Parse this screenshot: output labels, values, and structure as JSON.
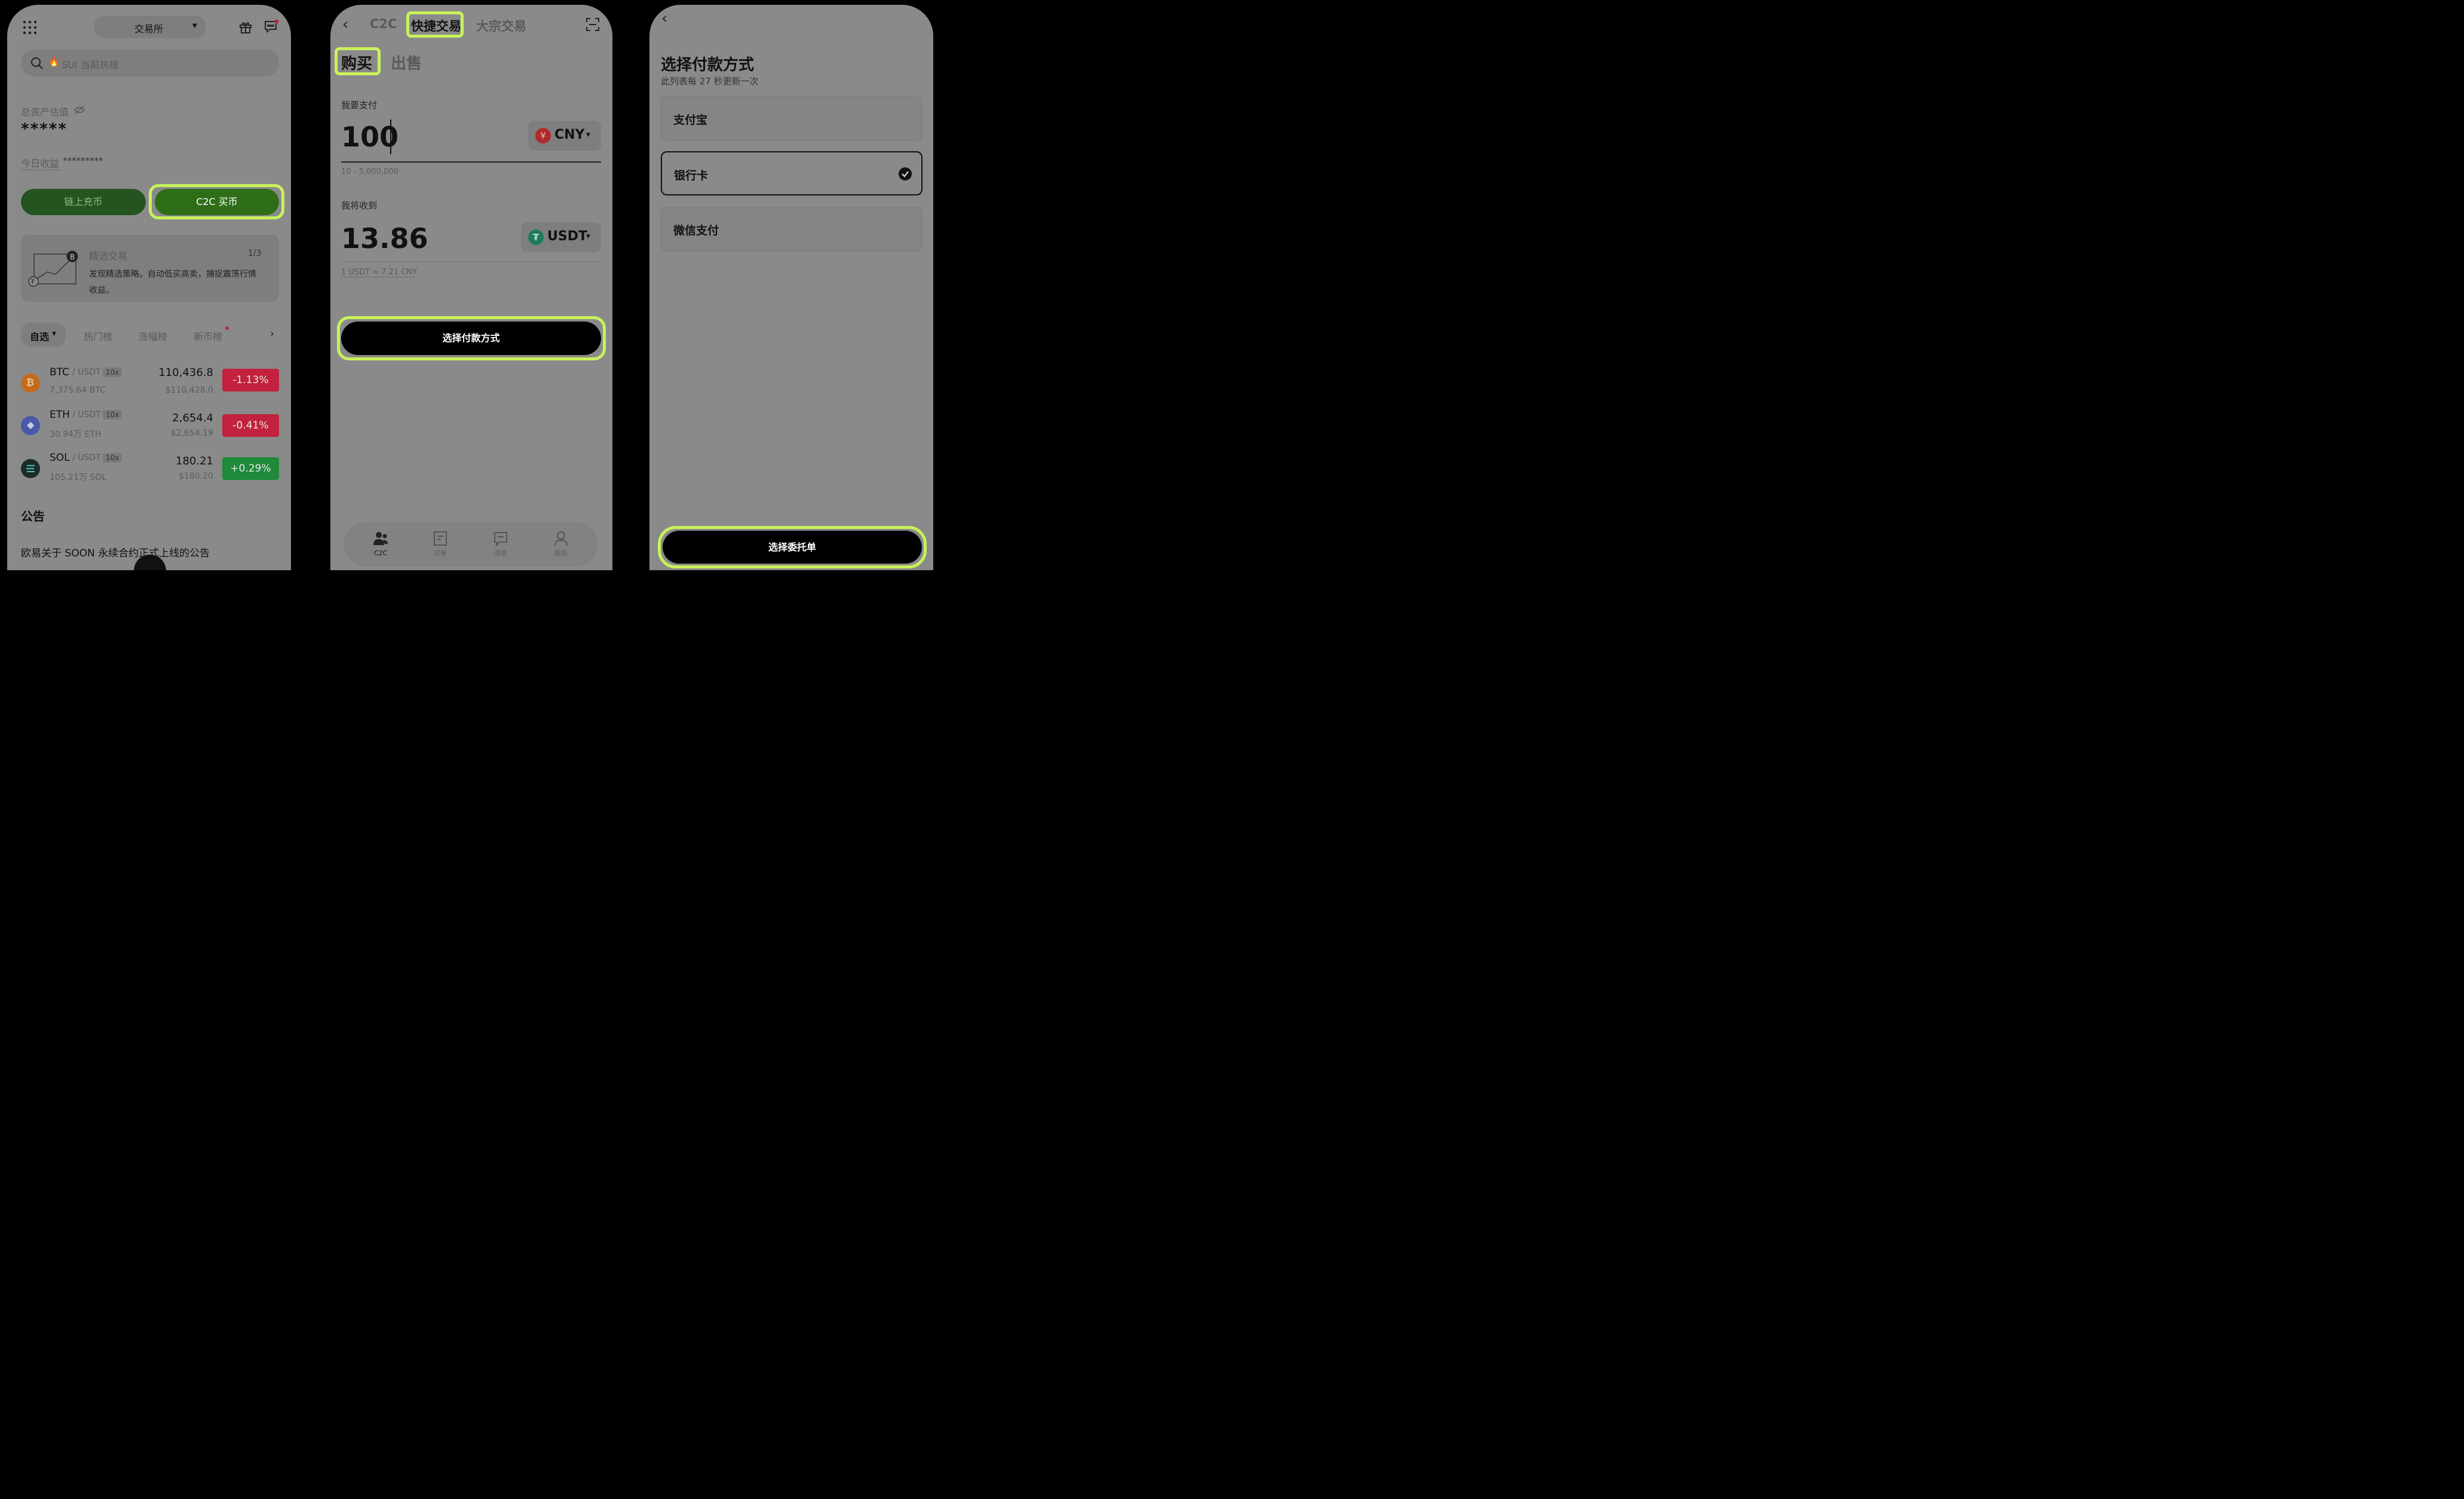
{
  "phone1": {
    "exchange_selector": "交易所",
    "search_placeholder": "SUI 当前热搜",
    "assets_label": "总资产估值",
    "assets_value": "*****",
    "today_label": "今日收益",
    "today_value": "*********",
    "onchain_btn": "链上充币",
    "c2c_btn": "C2C 买币",
    "promo": {
      "title": "精选交易",
      "pager": "1/3",
      "text1": "发现精选策略。自动低买高卖，捕捉震荡行情",
      "text2": "收益。"
    },
    "tabs": [
      "自选",
      "热门榜",
      "涨幅榜",
      "新币榜"
    ],
    "markets": [
      {
        "base": "BTC",
        "quote": "/ USDT",
        "lev": "10x",
        "vol": "7,375.64 BTC",
        "price": "110,436.8",
        "usd": "$110,428.0",
        "change": "-1.13%",
        "dir": "down"
      },
      {
        "base": "ETH",
        "quote": "/ USDT",
        "lev": "10x",
        "vol": "30.94万 ETH",
        "price": "2,654.4",
        "usd": "$2,654.19",
        "change": "-0.41%",
        "dir": "down"
      },
      {
        "base": "SOL",
        "quote": "/ USDT",
        "lev": "10x",
        "vol": "105.21万 SOL",
        "price": "180.21",
        "usd": "$180.20",
        "change": "+0.29%",
        "dir": "up"
      }
    ],
    "announce_title": "公告",
    "announce_item": "欧易关于 SOON 永续合约正式上线的公告"
  },
  "phone2": {
    "top_tabs": [
      "C2C",
      "快捷交易",
      "大宗交易"
    ],
    "side_tabs": [
      "购买",
      "出售"
    ],
    "pay_label": "我要支付",
    "pay_amount": "100",
    "pay_currency": "CNY",
    "pay_range": "10 - 5,000,000",
    "receive_label": "我将收到",
    "receive_amount": "13.86",
    "receive_currency": "USDT",
    "rate": "1 USDT ≈ 7.21 CNY",
    "select_btn": "选择付款方式",
    "nav": [
      "C2C",
      "订单",
      "消息",
      "我的"
    ]
  },
  "phone3": {
    "title": "选择付款方式",
    "subtitle": "此列表每 27 秒更新一次",
    "options": [
      "支付宝",
      "银行卡",
      "微信支付"
    ],
    "selected_index": 1,
    "bottom_btn": "选择委托单"
  },
  "colors": {
    "highlight": "#c8f25a",
    "green": "#2d6e17",
    "red": "#c2223d",
    "up_green": "#1e8a3a"
  }
}
